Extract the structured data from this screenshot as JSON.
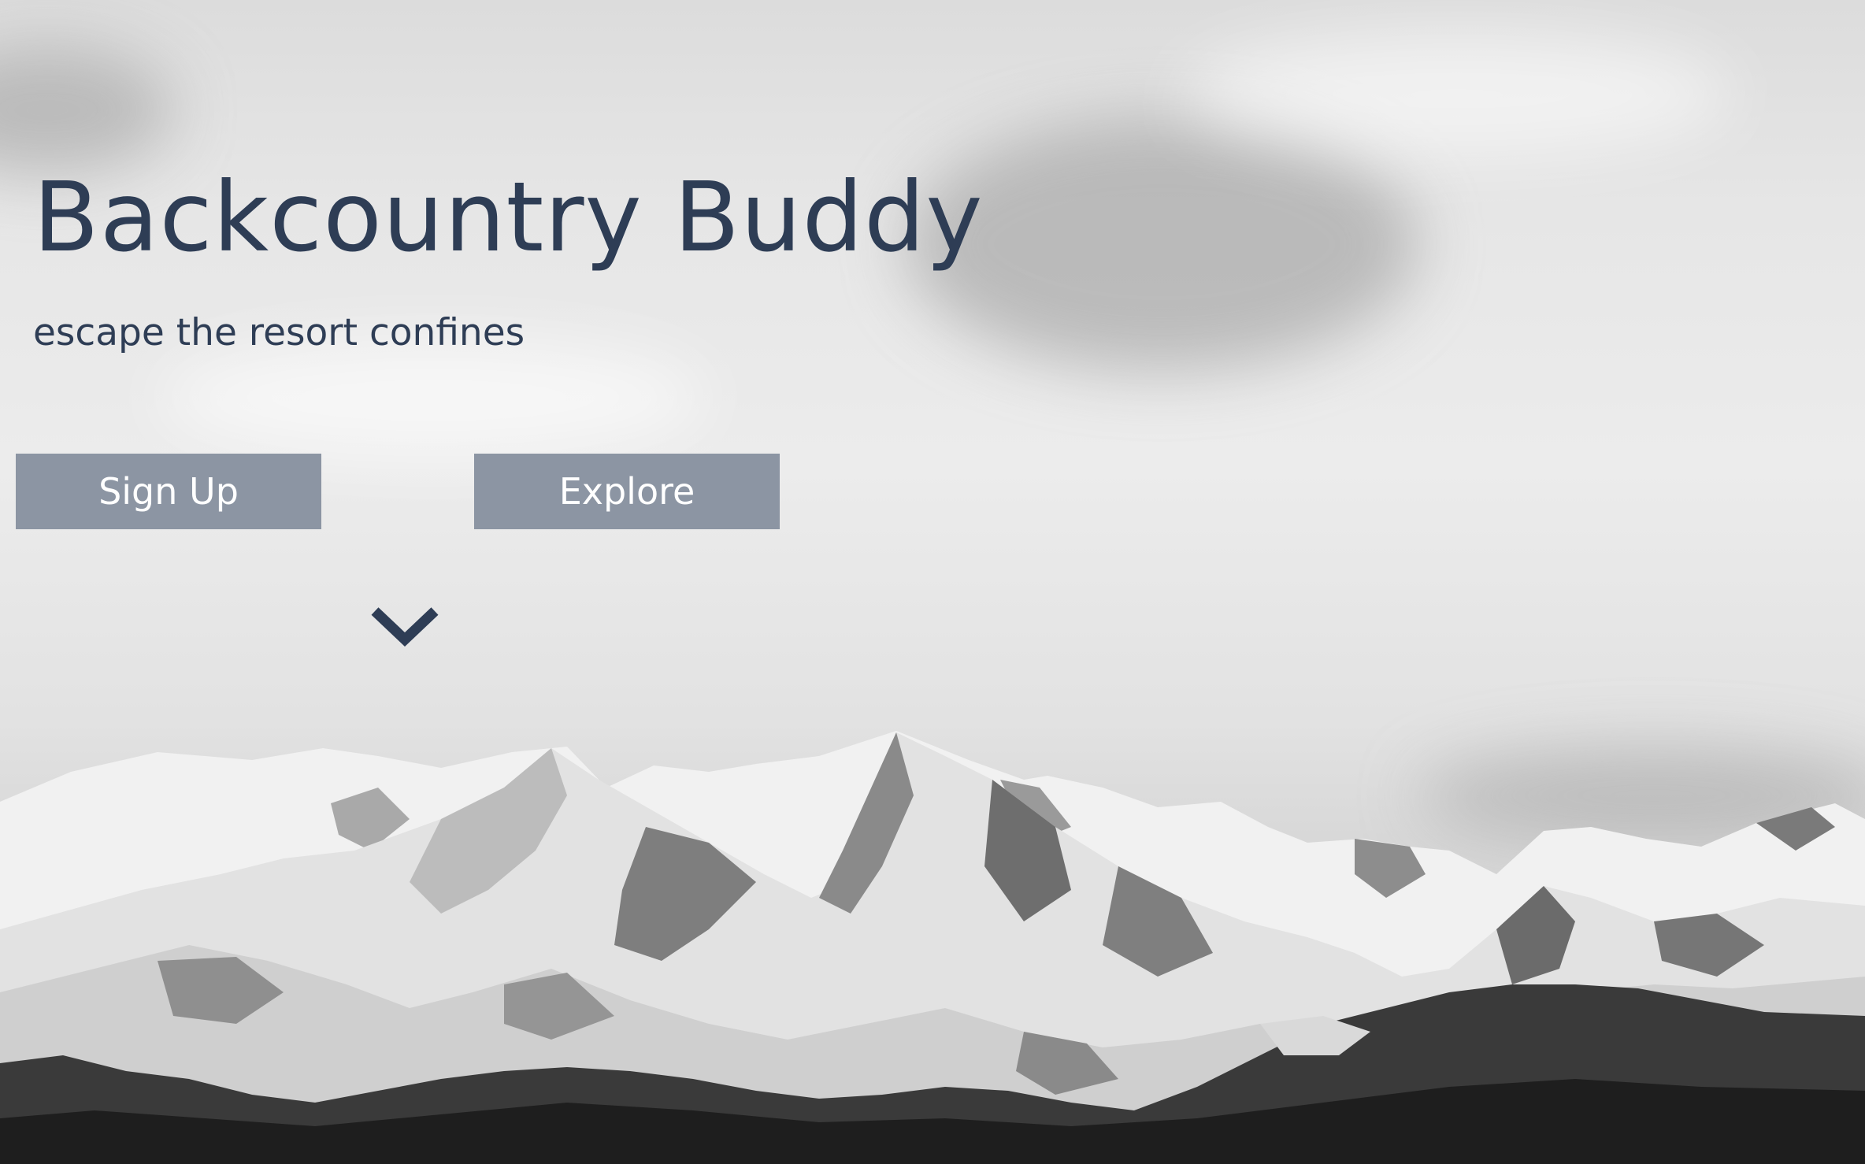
{
  "hero": {
    "title": "Backcountry Buddy",
    "subtitle": "escape the resort confines",
    "buttons": {
      "signup_label": "Sign Up",
      "explore_label": "Explore"
    },
    "scroll_icon": "chevron-down-icon"
  },
  "colors": {
    "text": "#2e3d55",
    "button_bg": "#8c95a3",
    "button_text": "#ffffff"
  }
}
